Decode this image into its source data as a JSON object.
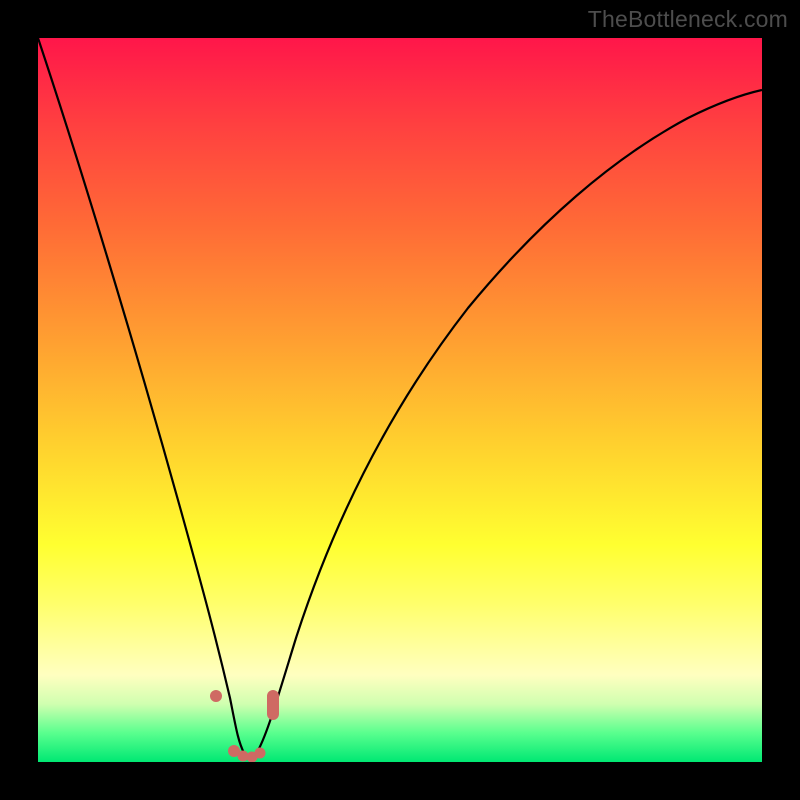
{
  "watermark": "TheBottleneck.com",
  "colors": {
    "frame": "#000000",
    "curve": "#000000",
    "marker": "#cf6a63"
  },
  "chart_data": {
    "type": "line",
    "title": "",
    "xlabel": "",
    "ylabel": "",
    "xlim": [
      0,
      1
    ],
    "ylim": [
      0,
      1
    ],
    "note": "No axis labels or tick labels are rendered in the image. Values below are estimated normalized coordinates (0..1) read from the plot area; y is bottleneck/mismatch percentage where 0 = no bottleneck (green) and 1 = max (red). The curve appears to be a V-shaped bottleneck curve with its minimum near x ≈ 0.29.",
    "series": [
      {
        "name": "bottleneck-curve",
        "x": [
          0.0,
          0.05,
          0.1,
          0.15,
          0.2,
          0.24,
          0.27,
          0.285,
          0.3,
          0.32,
          0.35,
          0.4,
          0.45,
          0.5,
          0.55,
          0.6,
          0.65,
          0.7,
          0.75,
          0.8,
          0.85,
          0.9,
          0.95,
          1.0
        ],
        "y": [
          1.0,
          0.86,
          0.7,
          0.52,
          0.32,
          0.15,
          0.05,
          0.01,
          0.005,
          0.02,
          0.07,
          0.2,
          0.33,
          0.44,
          0.54,
          0.62,
          0.69,
          0.75,
          0.8,
          0.84,
          0.86,
          0.89,
          0.91,
          0.92
        ]
      }
    ],
    "markers": {
      "name": "highlighted-points",
      "x": [
        0.24,
        0.268,
        0.283,
        0.296,
        0.309,
        0.322,
        0.322
      ],
      "y": [
        0.088,
        0.015,
        0.008,
        0.006,
        0.012,
        0.07,
        0.092
      ]
    }
  }
}
